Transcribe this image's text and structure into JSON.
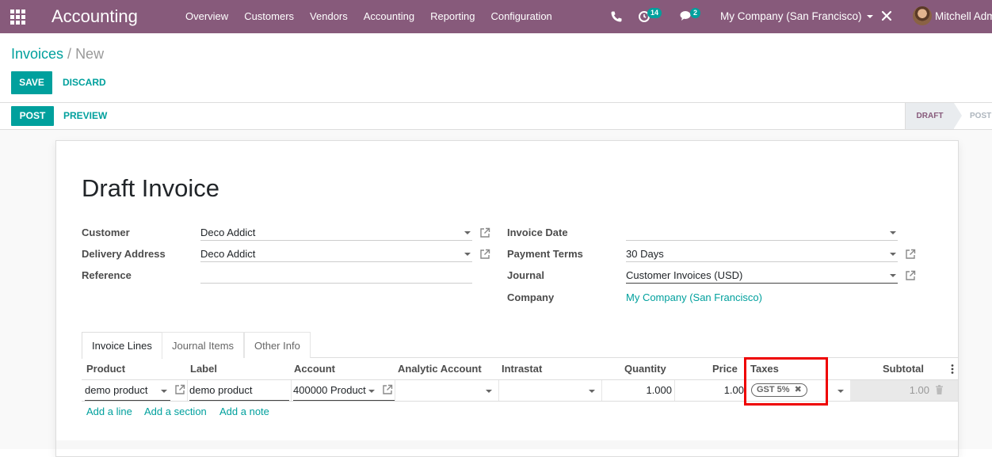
{
  "navbar": {
    "app_title": "Accounting",
    "menu": [
      "Overview",
      "Customers",
      "Vendors",
      "Accounting",
      "Reporting",
      "Configuration"
    ],
    "activity_count": "14",
    "message_count": "2",
    "company": "My Company (San Francisco)",
    "user": "Mitchell Adm"
  },
  "breadcrumb": {
    "parent": "Invoices",
    "separator": "/",
    "current": "New"
  },
  "buttons": {
    "save": "SAVE",
    "discard": "DISCARD",
    "post": "POST",
    "preview": "PREVIEW"
  },
  "statusbar": {
    "draft": "DRAFT",
    "posted": "POST"
  },
  "form": {
    "title": "Draft Invoice",
    "customer_label": "Customer",
    "customer_value": "Deco Addict",
    "delivery_label": "Delivery Address",
    "delivery_value": "Deco Addict",
    "reference_label": "Reference",
    "reference_value": "",
    "invoice_date_label": "Invoice Date",
    "invoice_date_value": "",
    "payment_terms_label": "Payment Terms",
    "payment_terms_value": "30 Days",
    "journal_label": "Journal",
    "journal_value": "Customer Invoices (USD)",
    "company_label": "Company",
    "company_value": "My Company (San Francisco)"
  },
  "tabs": [
    "Invoice Lines",
    "Journal Items",
    "Other Info"
  ],
  "lines": {
    "headers": {
      "product": "Product",
      "label": "Label",
      "account": "Account",
      "analytic": "Analytic Account",
      "intrastat": "Intrastat",
      "quantity": "Quantity",
      "price": "Price",
      "taxes": "Taxes",
      "subtotal": "Subtotal"
    },
    "row": {
      "product": "demo product",
      "label": "demo product",
      "account": "400000 Product",
      "analytic": "",
      "intrastat": "",
      "quantity": "1.000",
      "price": "1.00",
      "tax_tag": "GST 5%",
      "subtotal": "1.00"
    },
    "add_line": "Add a line",
    "add_section": "Add a section",
    "add_note": "Add a note"
  },
  "colors": {
    "navbar": "#875a7b",
    "primary": "#00a09d",
    "highlight": "#e00000"
  }
}
